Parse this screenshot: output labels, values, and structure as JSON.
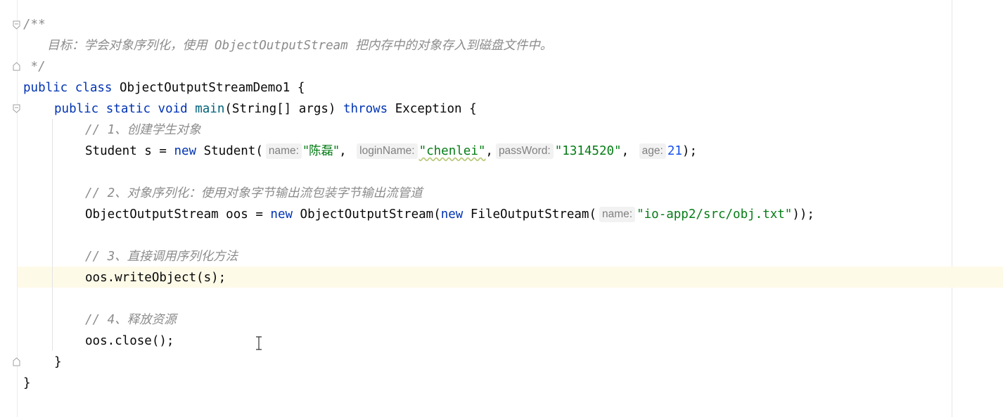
{
  "editor": {
    "line1": "/**",
    "line2": "目标：学会对象序列化，使用 ObjectOutputStream 把内存中的对象存入到磁盘文件中。",
    "line3": " */",
    "class_kw1": "public",
    "class_kw2": "class",
    "class_name": "ObjectOutputStreamDemo1 {",
    "main_kw1": "public",
    "main_kw2": "static",
    "main_kw3": "void",
    "main_name": "main",
    "main_params": "(String[] args) ",
    "main_throws": "throws",
    "main_tail": " Exception {",
    "comment1": "// 1、创建学生对象",
    "stu_decl": "Student s = ",
    "stu_new": "new",
    "stu_ctor": " Student(",
    "hint_name": "name:",
    "val_name": "\"陈磊\"",
    "hint_login": "loginName:",
    "val_login": "\"chenlei\"",
    "hint_pass": "passWord:",
    "val_pass": "\"1314520\"",
    "hint_age": "age:",
    "val_age": "21",
    "stu_end": ");",
    "comment2": "// 2、对象序列化：使用对象字节输出流包装字节输出流管道",
    "oos_decl": "ObjectOutputStream oos = ",
    "oos_new1": "new",
    "oos_ctor": " ObjectOutputStream(",
    "oos_new2": "new",
    "fos_ctor": " FileOutputStream(",
    "hint_fname": "name:",
    "val_path": "\"io-app2/src/obj.txt\"",
    "oos_end": "));",
    "comment3": "// 3、直接调用序列化方法",
    "write_call": "oos.writeObject(s);",
    "comment4": "// 4、释放资源",
    "close_call": "oos.close();",
    "close_method": "}",
    "close_class": "}"
  }
}
